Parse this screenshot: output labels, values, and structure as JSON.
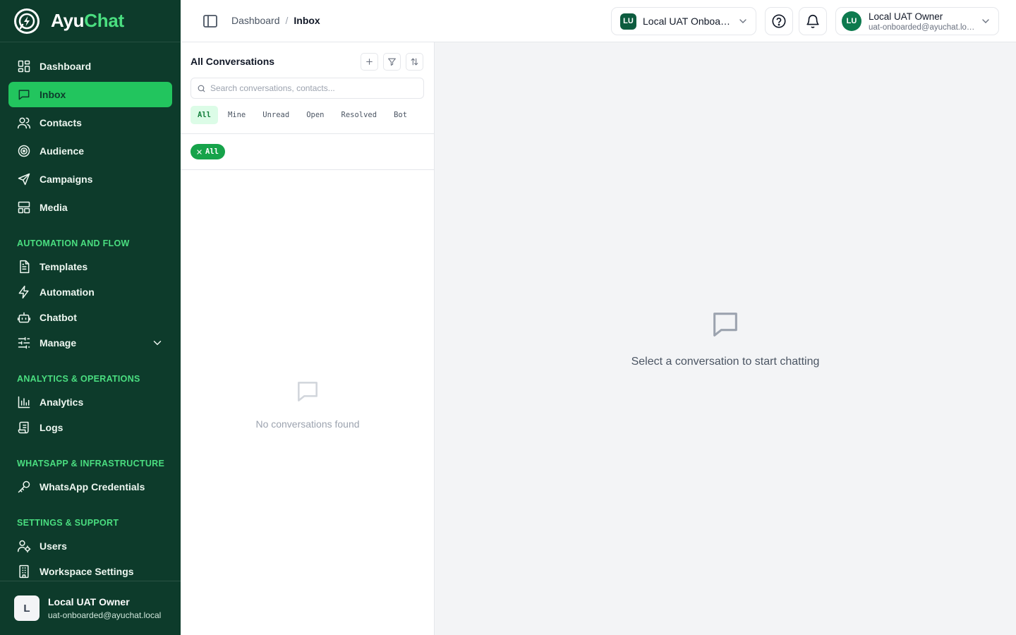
{
  "brand": {
    "name_part1": "Ayu",
    "name_part2": "Chat"
  },
  "colors": {
    "sidebar_bg": "#0d3b2b",
    "accent": "#22c55e",
    "section_label": "#4ade80"
  },
  "sidebar": {
    "main_items": [
      {
        "label": "Dashboard",
        "icon": "dashboard-icon"
      },
      {
        "label": "Inbox",
        "icon": "inbox-icon",
        "active": true
      },
      {
        "label": "Contacts",
        "icon": "contacts-icon"
      },
      {
        "label": "Audience",
        "icon": "target-icon"
      },
      {
        "label": "Campaigns",
        "icon": "send-icon"
      },
      {
        "label": "Media",
        "icon": "media-icon"
      }
    ],
    "sections": [
      {
        "label": "AUTOMATION AND FLOW",
        "items": [
          {
            "label": "Templates",
            "icon": "file-text-icon"
          },
          {
            "label": "Automation",
            "icon": "zap-icon"
          },
          {
            "label": "Chatbot",
            "icon": "bot-icon"
          },
          {
            "label": "Manage",
            "icon": "sliders-icon"
          }
        ]
      },
      {
        "label": "ANALYTICS & OPERATIONS",
        "items": [
          {
            "label": "Analytics",
            "icon": "bar-chart-icon"
          },
          {
            "label": "Logs",
            "icon": "scroll-icon"
          }
        ]
      },
      {
        "label": "WHATSAPP & INFRASTRUCTURE",
        "items": [
          {
            "label": "WhatsApp Credentials",
            "icon": "key-icon"
          }
        ]
      },
      {
        "label": "SETTINGS & SUPPORT",
        "items": [
          {
            "label": "Users",
            "icon": "user-cog-icon"
          },
          {
            "label": "Workspace Settings",
            "icon": "building-icon"
          }
        ]
      }
    ],
    "footer": {
      "avatar_letter": "L",
      "name": "Local UAT Owner",
      "email": "uat-onboarded@ayuchat.local"
    }
  },
  "header": {
    "breadcrumb": [
      "Dashboard",
      "Inbox"
    ],
    "breadcrumb_separator": "/",
    "workspace": {
      "badge": "LU",
      "name": "Local UAT Onboarded"
    },
    "user": {
      "initials": "LU",
      "name": "Local UAT Owner",
      "email": "uat-onboarded@ayuchat.local"
    }
  },
  "conversations": {
    "title": "All Conversations",
    "search_placeholder": "Search conversations, contacts...",
    "filters": [
      "All",
      "Mine",
      "Unread",
      "Open",
      "Resolved",
      "Bot"
    ],
    "active_filter": "All",
    "active_chip": "All",
    "empty_text": "No conversations found"
  },
  "chat": {
    "empty_text": "Select a conversation to start chatting"
  }
}
